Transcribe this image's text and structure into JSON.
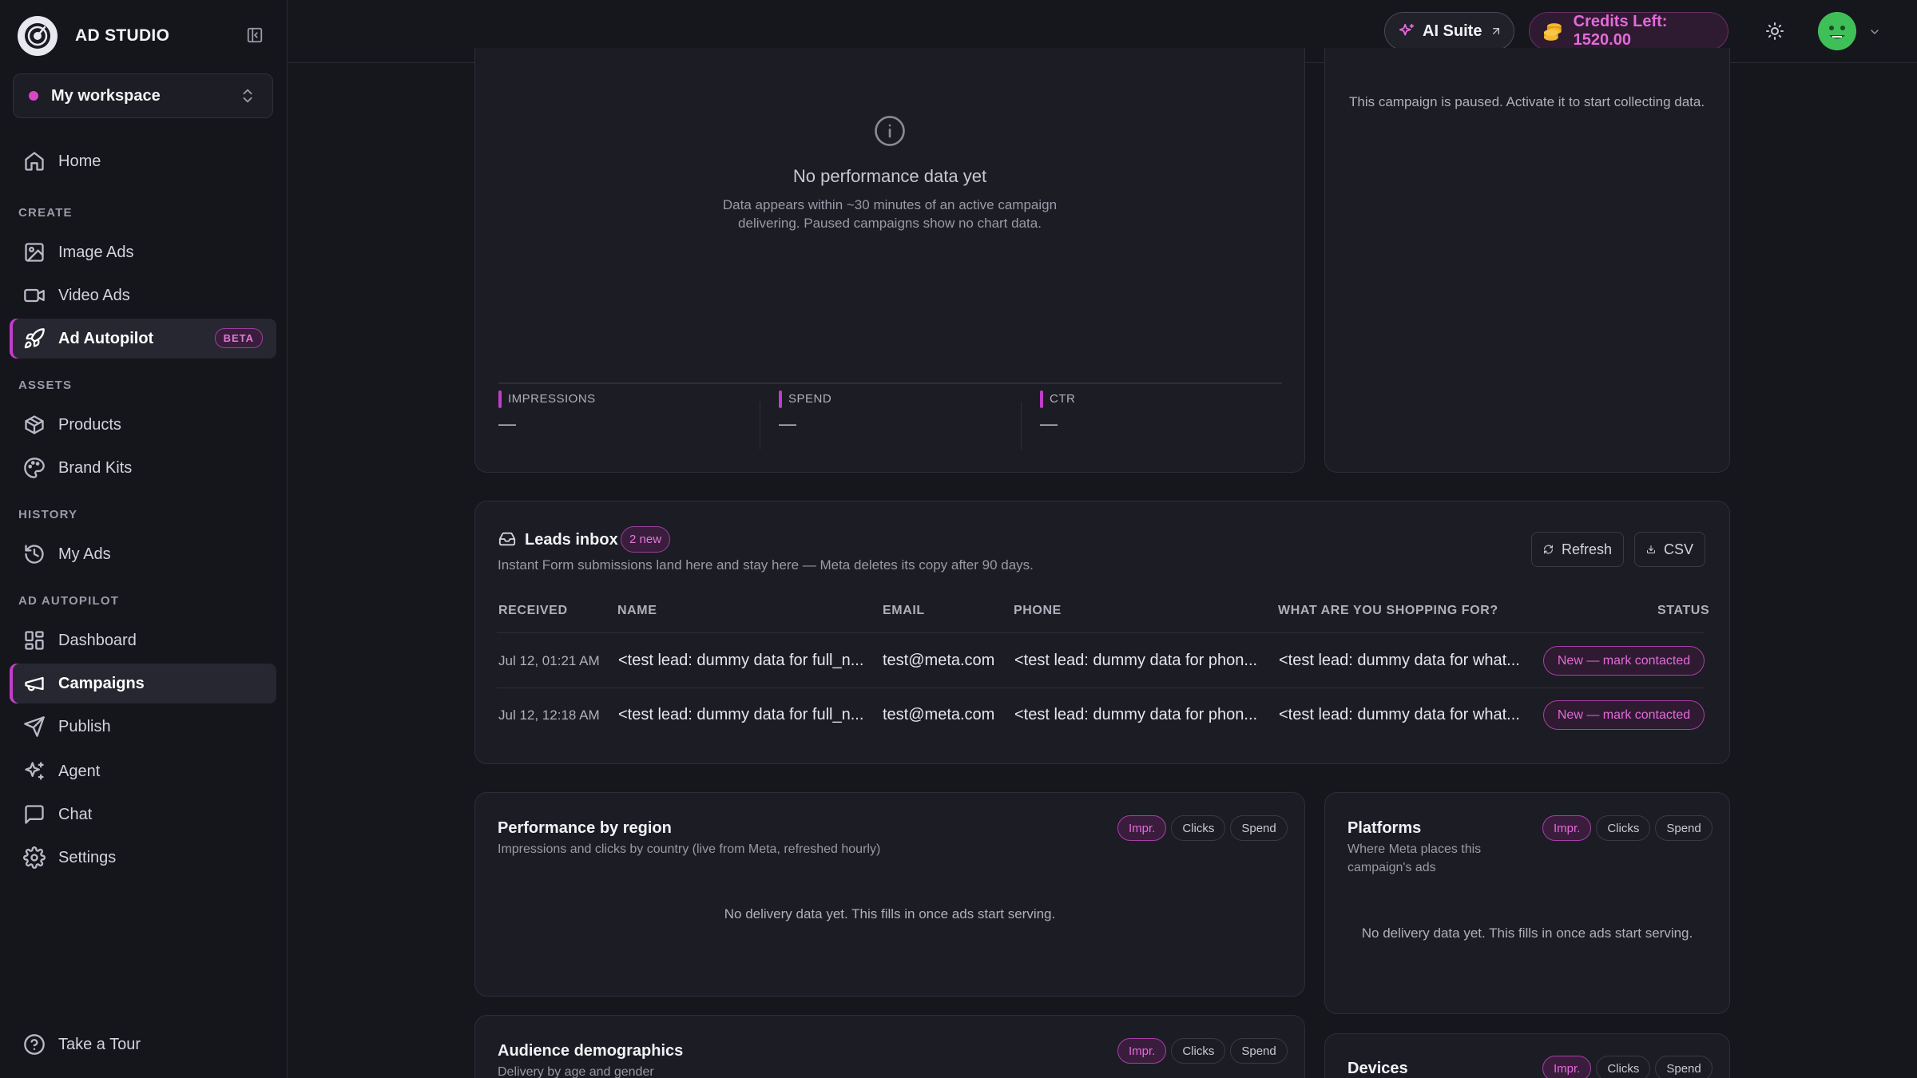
{
  "brand": {
    "name": "AD STUDIO"
  },
  "workspace": {
    "name": "My workspace"
  },
  "nav": {
    "home": "Home",
    "sections": {
      "create": "CREATE",
      "assets": "ASSETS",
      "history": "HISTORY",
      "autopilot": "AD AUTOPILOT"
    },
    "image_ads": "Image Ads",
    "video_ads": "Video Ads",
    "ad_autopilot": "Ad Autopilot",
    "beta": "BETA",
    "products": "Products",
    "brand_kits": "Brand Kits",
    "my_ads": "My Ads",
    "dashboard": "Dashboard",
    "campaigns": "Campaigns",
    "publish": "Publish",
    "agent": "Agent",
    "chat": "Chat",
    "settings": "Settings",
    "tour": "Take a Tour"
  },
  "topbar": {
    "ai_suite": "AI Suite",
    "credits": "Credits Left: 1520.00"
  },
  "performance": {
    "empty_title": "No performance data yet",
    "empty_line1": "Data appears within ~30 minutes of an active campaign",
    "empty_line2": "delivering. Paused campaigns show no chart data.",
    "metrics": [
      {
        "name": "IMPRESSIONS",
        "value": "—"
      },
      {
        "name": "SPEND",
        "value": "—"
      },
      {
        "name": "CTR",
        "value": "—"
      }
    ]
  },
  "side_panel": {
    "message": "This campaign is paused. Activate it to start collecting data."
  },
  "leads": {
    "title": "Leads inbox",
    "badge": "2 new",
    "subtitle": "Instant Form submissions land here and stay here — Meta deletes its copy after 90 days.",
    "refresh": "Refresh",
    "csv": "CSV",
    "columns": [
      "RECEIVED",
      "NAME",
      "EMAIL",
      "PHONE",
      "WHAT ARE YOU SHOPPING FOR?",
      "STATUS"
    ],
    "rows": [
      {
        "received": "Jul 12, 01:21 AM",
        "name": "<test lead: dummy data for full_n...",
        "email": "test@meta.com",
        "phone": "<test lead: dummy data for phon...",
        "shopping": "<test lead: dummy data for what...",
        "status": "New — mark contacted"
      },
      {
        "received": "Jul 12, 12:18 AM",
        "name": "<test lead: dummy data for full_n...",
        "email": "test@meta.com",
        "phone": "<test lead: dummy data for phon...",
        "shopping": "<test lead: dummy data for what...",
        "status": "New — mark contacted"
      }
    ]
  },
  "region": {
    "title": "Performance by region",
    "subtitle": "Impressions and clicks by country (live from Meta, refreshed hourly)",
    "empty": "No delivery data yet. This fills in once ads start serving."
  },
  "platforms": {
    "title": "Platforms",
    "subtitle_line1": "Where Meta places this",
    "subtitle_line2": "campaign's ads",
    "empty": "No delivery data yet. This fills in once ads start serving."
  },
  "demographics": {
    "title": "Audience demographics",
    "subtitle": "Delivery by age and gender"
  },
  "devices": {
    "title": "Devices"
  },
  "toggles": {
    "impr": "Impr.",
    "clicks": "Clicks",
    "spend": "Spend"
  },
  "colors": {
    "accent": "#c03dc9",
    "accent_text": "#e46ad9",
    "background": "#16161d",
    "card": "#1c1c24"
  }
}
